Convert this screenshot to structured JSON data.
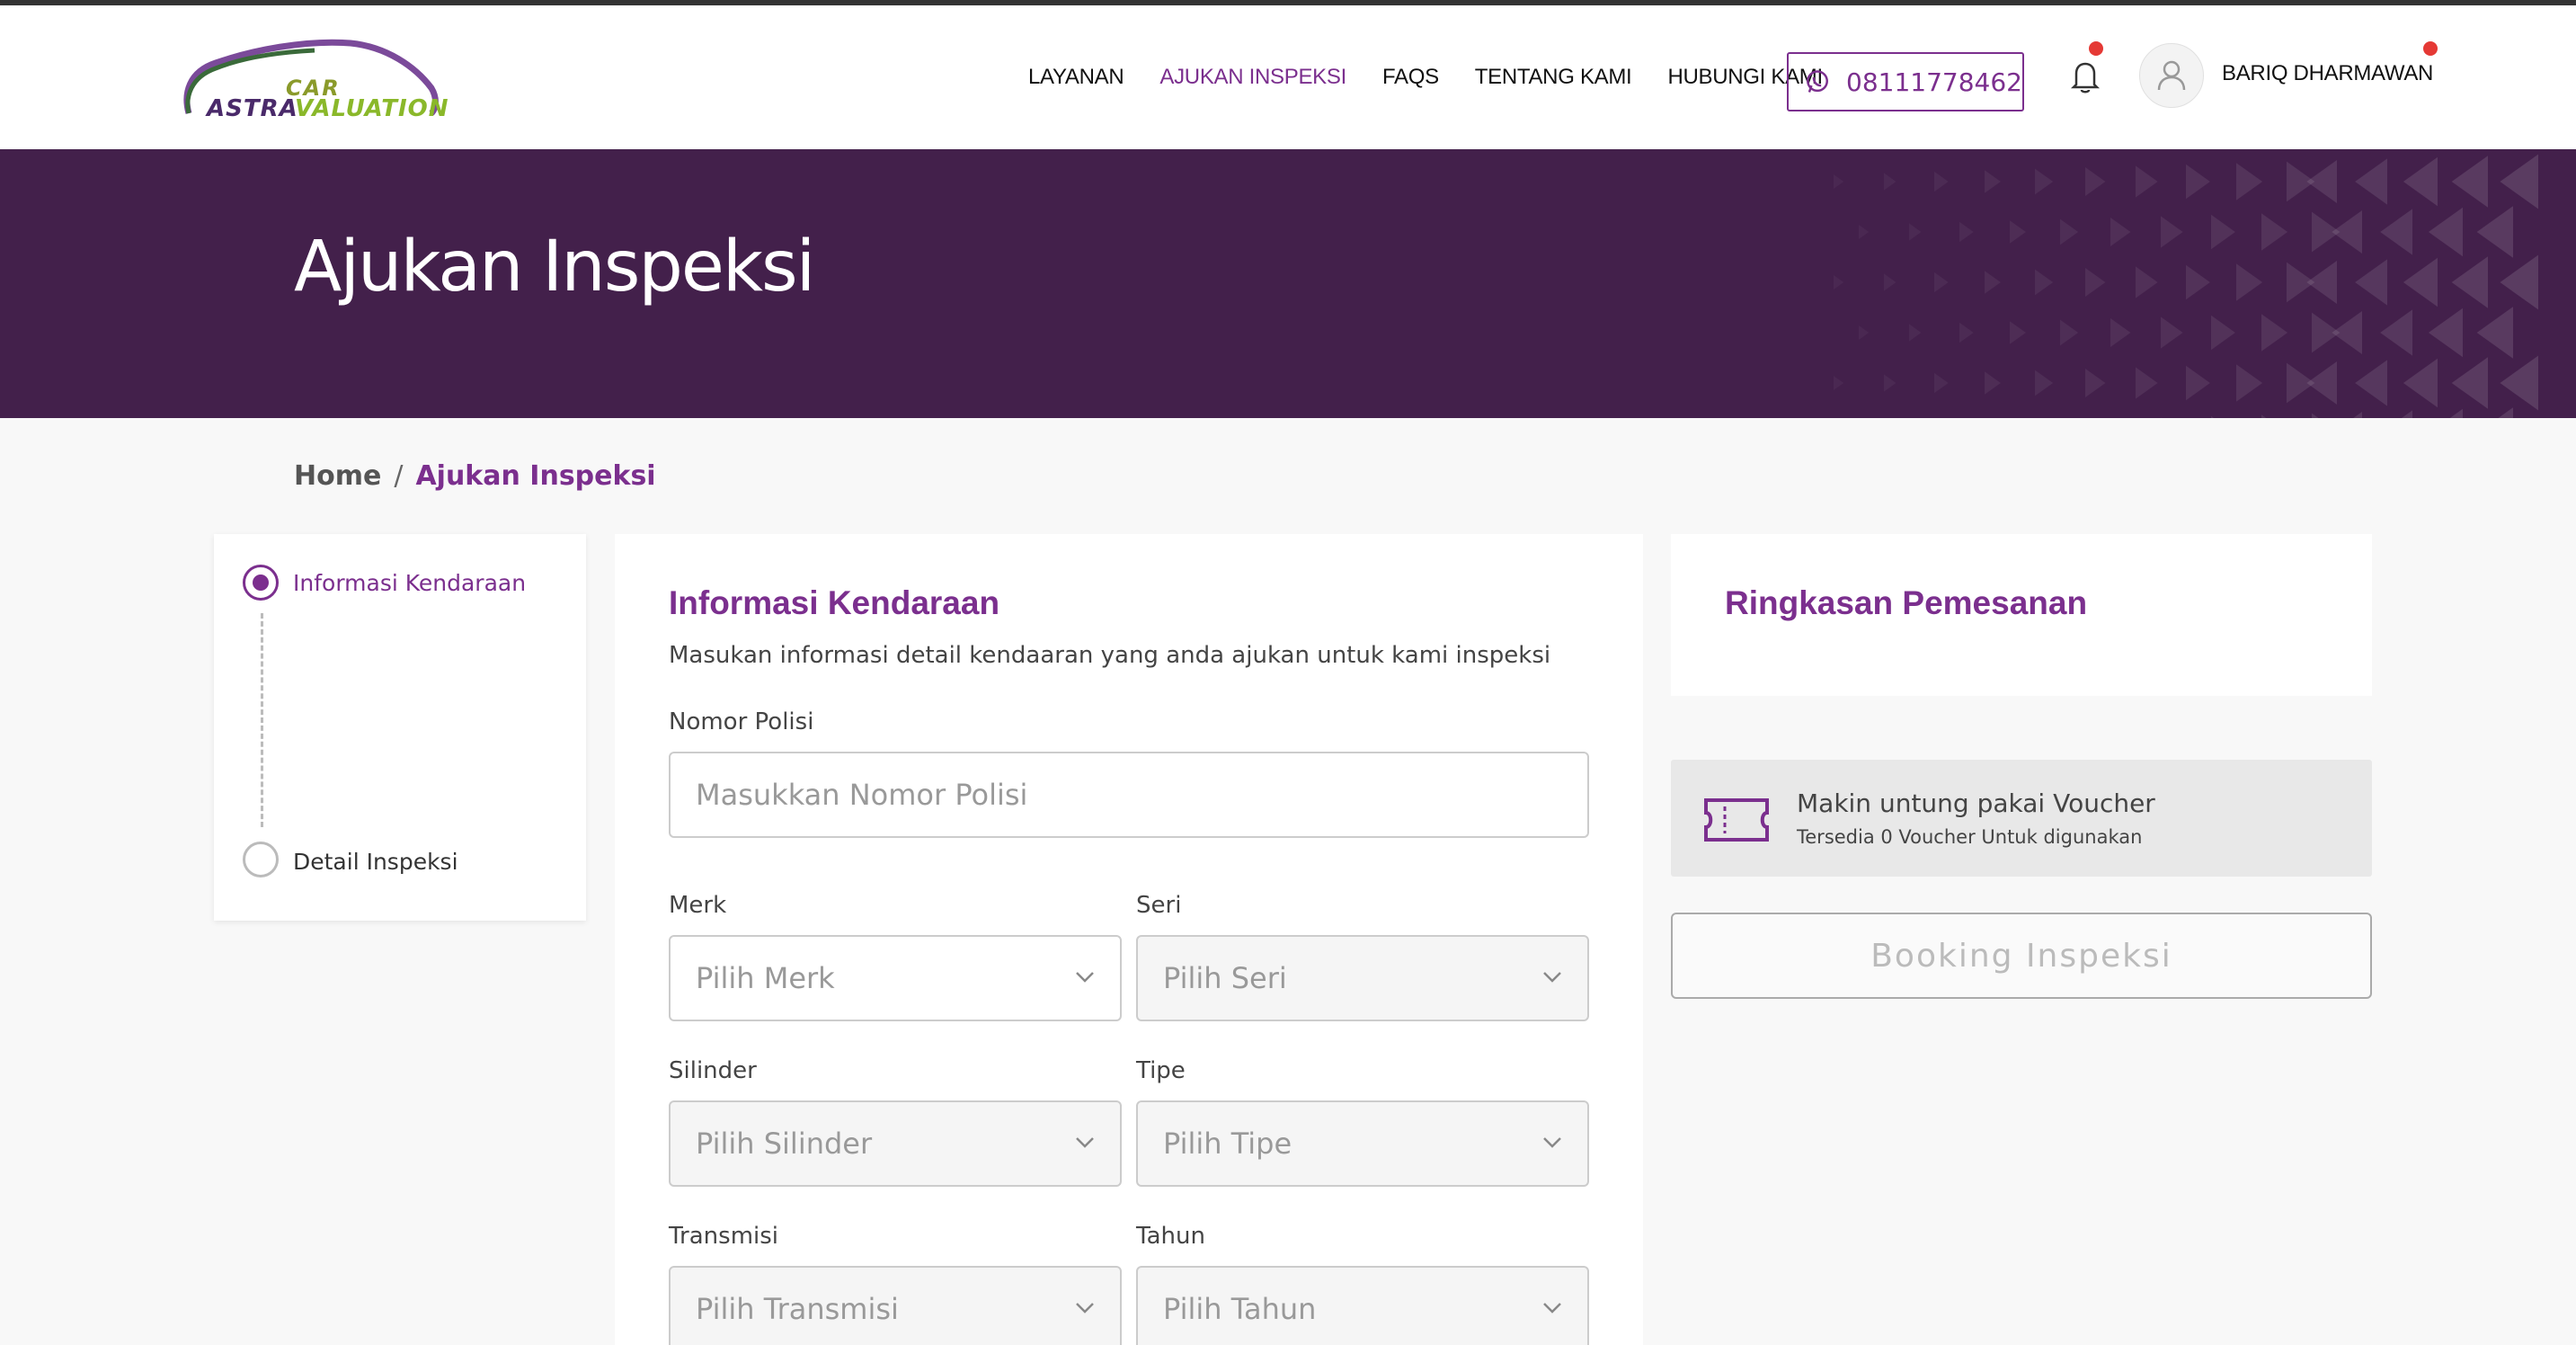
{
  "brand": {
    "logo_line1": "CAR",
    "logo_word1": "ASTRA",
    "logo_word2": "VALUATION",
    "accent": "#7b2f8e",
    "banner_color": "#43204b"
  },
  "nav": {
    "items": [
      {
        "label": "LAYANAN",
        "active": false
      },
      {
        "label": "AJUKAN INSPEKSI",
        "active": true
      },
      {
        "label": "FAQS",
        "active": false
      },
      {
        "label": "TENTANG KAMI",
        "active": false
      },
      {
        "label": "HUBUNGI KAMI",
        "active": false
      }
    ],
    "whatsapp_number": "08111778462",
    "user_name": "BARIQ DHARMAWAN"
  },
  "banner": {
    "title": "Ajukan Inspeksi"
  },
  "breadcrumb": {
    "home": "Home",
    "separator": "/",
    "current": "Ajukan Inspeksi"
  },
  "steps": [
    {
      "label": "Informasi Kendaraan",
      "active": true
    },
    {
      "label": "Detail Inspeksi",
      "active": false
    }
  ],
  "form": {
    "title": "Informasi Kendaraan",
    "description": "Masukan informasi detail kendaaran yang anda ajukan untuk kami inspeksi",
    "nomor_polisi": {
      "label": "Nomor Polisi",
      "placeholder": "Masukkan Nomor Polisi"
    },
    "merk": {
      "label": "Merk",
      "placeholder": "Pilih Merk"
    },
    "seri": {
      "label": "Seri",
      "placeholder": "Pilih Seri"
    },
    "silinder": {
      "label": "Silinder",
      "placeholder": "Pilih Silinder"
    },
    "tipe": {
      "label": "Tipe",
      "placeholder": "Pilih Tipe"
    },
    "transmisi": {
      "label": "Transmisi",
      "placeholder": "Pilih Transmisi"
    },
    "tahun": {
      "label": "Tahun",
      "placeholder": "Pilih Tahun"
    }
  },
  "summary": {
    "title": "Ringkasan Pemesanan",
    "voucher_title": "Makin untung pakai Voucher",
    "voucher_sub": "Tersedia 0 Voucher Untuk digunakan",
    "booking_button": "Booking Inspeksi"
  }
}
